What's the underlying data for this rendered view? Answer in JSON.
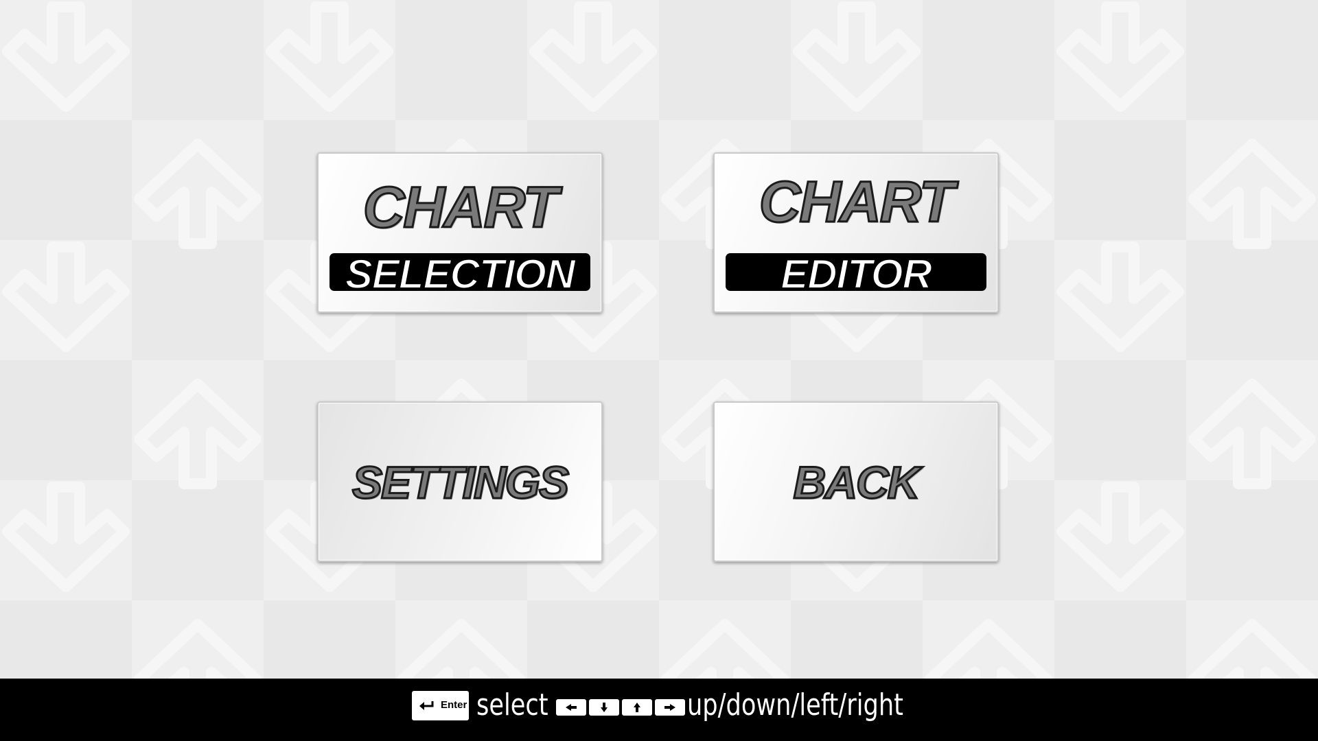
{
  "menu": {
    "chart_selection": {
      "line1": "CHART",
      "line2": "SELECTION"
    },
    "chart_editor": {
      "line1": "CHART",
      "line2": "EDITOR"
    },
    "settings": {
      "label": "SETTINGS"
    },
    "back": {
      "label": "BACK"
    }
  },
  "footer": {
    "enter_key_label": "Enter",
    "select_hint": "select",
    "nav_hint": "up/down/left/right"
  },
  "icons": {
    "background": "arrow-pattern",
    "enter": "enter-key-icon",
    "arrows": [
      "arrow-left-key-icon",
      "arrow-down-key-icon",
      "arrow-up-key-icon",
      "arrow-right-key-icon"
    ]
  },
  "colors": {
    "background": "#ececec",
    "footer": "#000000",
    "button_text": "#7a7a7a"
  }
}
